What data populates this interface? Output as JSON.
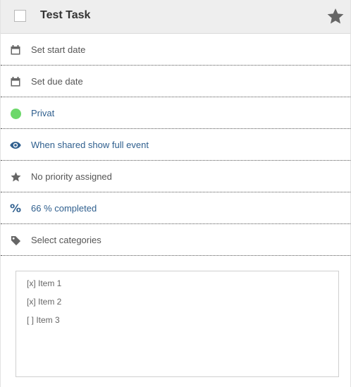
{
  "task": {
    "title": "Test Task",
    "done": false,
    "starred": false
  },
  "rows": [
    {
      "icon": "calendar-icon",
      "label": "Set start date",
      "style": "muted"
    },
    {
      "icon": "calendar-icon",
      "label": "Set due date",
      "style": "muted"
    },
    {
      "icon": "green-dot-icon",
      "label": "Privat",
      "style": "link",
      "color": "#6cd86a"
    },
    {
      "icon": "eye-icon",
      "label": "When shared show full event",
      "style": "link"
    },
    {
      "icon": "star-icon",
      "label": "No priority assigned",
      "style": "muted"
    },
    {
      "icon": "percent-icon",
      "label": "66 % completed",
      "style": "link",
      "progress": 66
    },
    {
      "icon": "tag-icon",
      "label": "Select categories",
      "style": "muted"
    }
  ],
  "notes": {
    "lines": [
      "[x] Item 1",
      "[x] Item 2",
      "[ ] Item 3"
    ]
  },
  "colors": {
    "link": "#2f5f8e",
    "muted": "#555555",
    "privacy_dot": "#6cd86a",
    "header_bg": "#eeeeee"
  }
}
